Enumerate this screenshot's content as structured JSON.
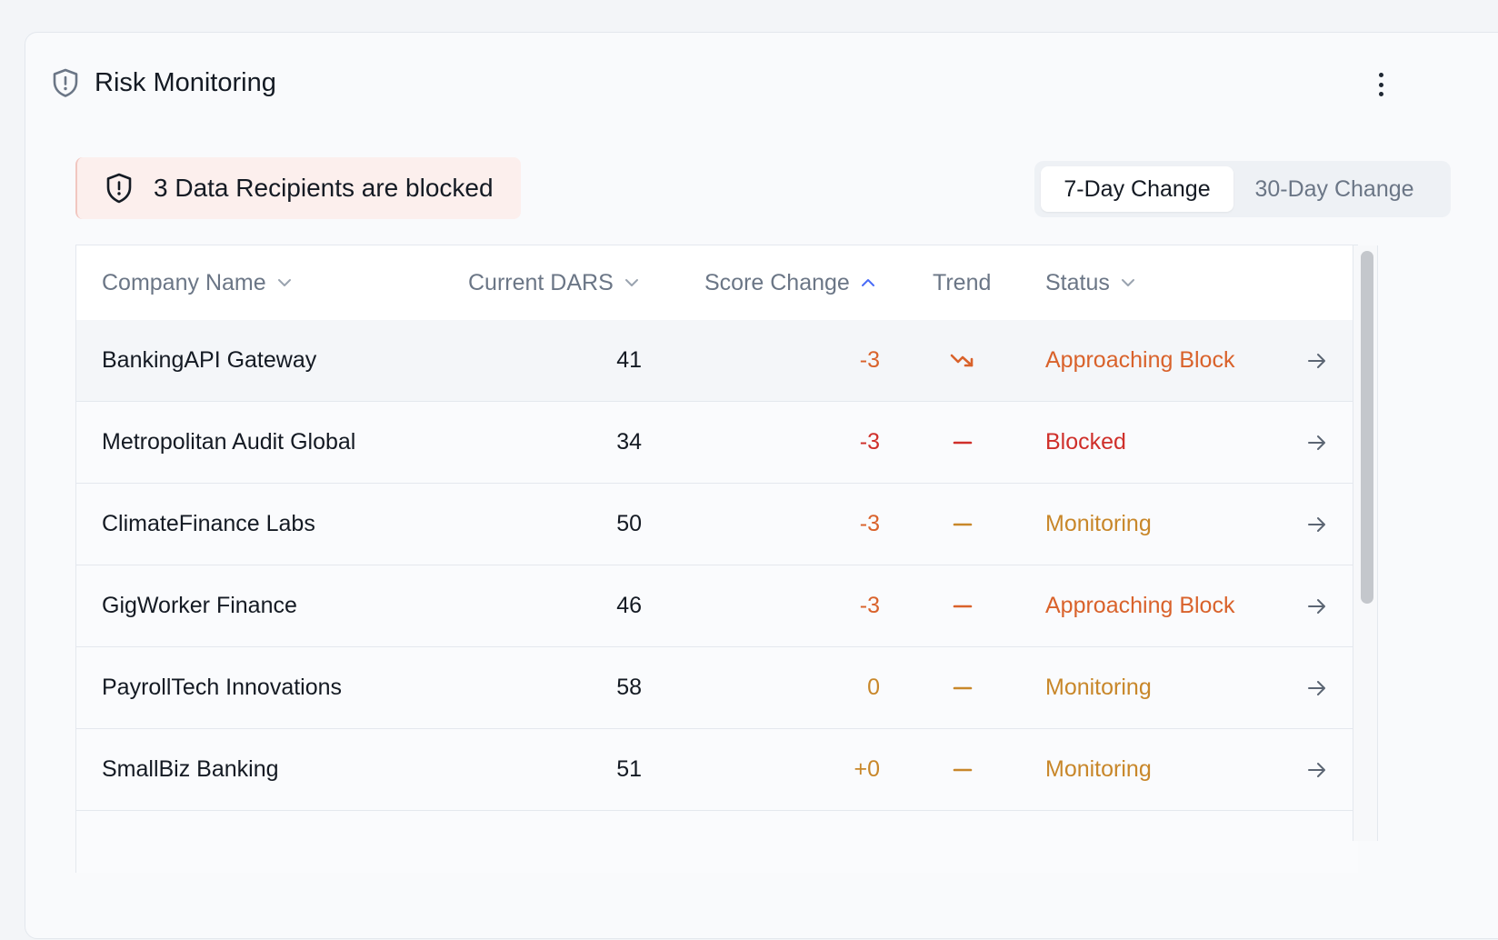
{
  "header": {
    "title": "Risk Monitoring",
    "icon": "shield-alert-icon",
    "menu_icon": "kebab-menu-icon"
  },
  "alert": {
    "text": "3 Data Recipients are blocked",
    "icon": "shield-alert-icon",
    "bg_color": "#fcefed"
  },
  "period_toggle": {
    "options": [
      {
        "label": "7-Day Change",
        "selected": true
      },
      {
        "label": "30-Day Change",
        "selected": false
      }
    ]
  },
  "table": {
    "columns": [
      {
        "label": "Company Name",
        "sort_icon": "chevron-down-icon"
      },
      {
        "label": "Current DARS",
        "sort_icon": "chevron-down-icon"
      },
      {
        "label": "Score Change",
        "sort_icon": "chevron-up-icon"
      },
      {
        "label": "Trend",
        "sort_icon": ""
      },
      {
        "label": "Status",
        "sort_icon": "chevron-down-icon"
      }
    ],
    "rows": [
      {
        "company": "BankingAPI Gateway",
        "dars": "41",
        "score_change": "-3",
        "trend": "trending-down-icon",
        "status": "Approaching Block",
        "tone": "orange"
      },
      {
        "company": "Metropolitan Audit Global",
        "dars": "34",
        "score_change": "-3",
        "trend": "flat-dash-icon",
        "status": "Blocked",
        "tone": "red"
      },
      {
        "company": "ClimateFinance Labs",
        "dars": "50",
        "score_change": "-3",
        "trend": "flat-dash-icon",
        "status": "Monitoring",
        "tone": "amber"
      },
      {
        "company": "GigWorker Finance",
        "dars": "46",
        "score_change": "-3",
        "trend": "flat-dash-icon",
        "status": "Approaching Block",
        "tone": "orange"
      },
      {
        "company": "PayrollTech Innovations",
        "dars": "58",
        "score_change": "0",
        "trend": "flat-dash-icon",
        "status": "Monitoring",
        "tone": "amber"
      },
      {
        "company": "SmallBiz Banking",
        "dars": "51",
        "score_change": "+0",
        "trend": "flat-dash-icon",
        "status": "Monitoring",
        "tone": "amber"
      }
    ],
    "row_action_icon": "arrow-right-icon"
  },
  "colors": {
    "orange": "#d9622b",
    "red": "#cf2f2a",
    "amber": "#c8872a",
    "header_text": "#6b7686",
    "accent": "#4a6cf7"
  }
}
